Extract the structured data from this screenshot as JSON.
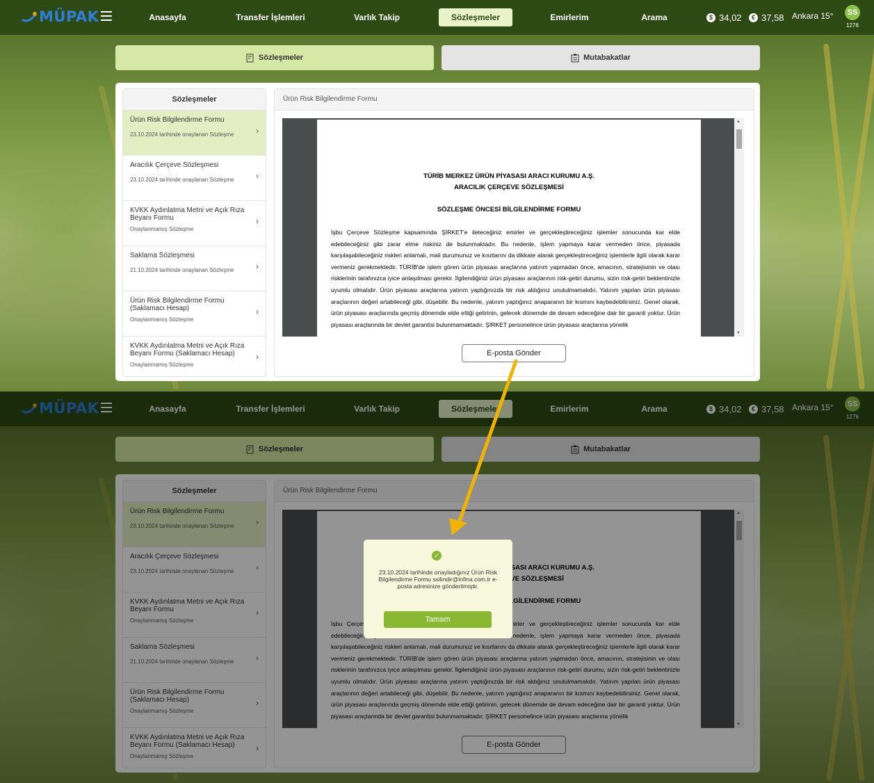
{
  "app": {
    "logo_text": "MÜPAK",
    "nav": [
      "Anasayfa",
      "Transfer İşlemleri",
      "Varlık Takip",
      "Sözleşmeler",
      "Emirlerim",
      "Arama"
    ],
    "active_nav": "Sözleşmeler",
    "currency1": "34,02",
    "currency2": "37,58",
    "weather": "Ankara 15°",
    "avatar_initials": "SS",
    "user_number": "1276"
  },
  "tabs": {
    "contracts": "Sözleşmeler",
    "reconciliations": "Mutabakatlar"
  },
  "sidebar": {
    "header": "Sözleşmeler",
    "items": [
      {
        "title": "Ürün Risk Bilgilendirme Formu",
        "subtitle": "23.10.2024 tarihinde onaylanan Sözleşme"
      },
      {
        "title": "Aracılık Çerçeve Sözleşmesi",
        "subtitle": "23.10.2024 tarihinde onaylanan Sözleşme"
      },
      {
        "title": "KVKK Aydınlatma Metni ve Açık Rıza Beyanı Formu",
        "subtitle": "Onaylanmamış Sözleşme"
      },
      {
        "title": "Saklama Sözleşmesi",
        "subtitle": "21.10.2024 tarihinde onaylanan Sözleşme"
      },
      {
        "title": "Ürün Risk Bilgilendirme Formu (Saklamacı Hesap)",
        "subtitle": "Onaylanmamış Sözleşme"
      },
      {
        "title": "KVKK Aydınlatma Metni ve Açık Rıza Beyanı Formu (Saklamacı Hesap)",
        "subtitle": "Onaylanmamış Sözleşme"
      }
    ]
  },
  "main": {
    "header": "Ürün Risk Bilgilendirme Formu",
    "email_button": "E-posta Gönder"
  },
  "document": {
    "title1": "TÜRİB MERKEZ ÜRÜN PİYASASI ARACI KURUMU A.Ş.",
    "title2": "ARACILIK ÇERÇEVE SÖZLEŞMESİ",
    "title3": "SÖZLEŞME ÖNCESİ BİLGİLENDİRME FORMU",
    "body": "İşbu Çerçeve Sözleşme kapsamında ŞİRKET'e ileteceğiniz emirler ve gerçekleştireceğiniz işlemler sonucunda kar elde edebileceğiniz gibi zarar etme riskiniz de bulunmaktadır. Bu nedenle, işlem yapmaya karar vermeden önce, piyasada karşılaşabileceğiniz riskleri anlamalı, mali durumunuz ve kısıtlarını da dikkate alarak gerçekleştireceğiniz işlemlerle ilgili olarak karar vermeniz gerekmektedir. TÜRİB'de işlem gören ürün piyasası araçlarına yatırım yapmadan önce, amacının, stratejisinin ve olası risklerinin tarafınızca iyice anlaşılması gerekir. İlgilendiğiniz ürün piyasası araçlarının risk-getiri durumu, sizin risk-getiri beklentinizle uyumlu olmalıdır. Ürün piyasası araçlarına yatırım yaptığınızda bir risk aldığınız unutulmamalıdır. Yatırım yapılan ürün piyasası araçlarının değeri artabileceği gibi, düşebilir. Bu nedenle, yatırım yaptığınız anaparanın bir kısmını kaybedebilirsiniz. Genel olarak, ürün piyasası araçlarında geçmiş dönemde elde ettiği getirinin, gelecek dönemde de devam edeceğine dair bir garanti yoktur. Ürün piyasası araçlarında bir devlet garantisi bulunmamaktadır. ŞİRKET personelince ürün piyasası araçlarına yönelik"
  },
  "modal": {
    "message": "23.10.2024 tarihinde onayladığınız Ürün Risk Bilgilendirme Formu ssilindir@infina.com.tr e-posta adresinize gönderilmiştir.",
    "ok_button": "Tamam"
  },
  "colors": {
    "topbar": "#2e4a14",
    "accent": "#8ab832",
    "annotation_arrow": "#f2b300"
  }
}
